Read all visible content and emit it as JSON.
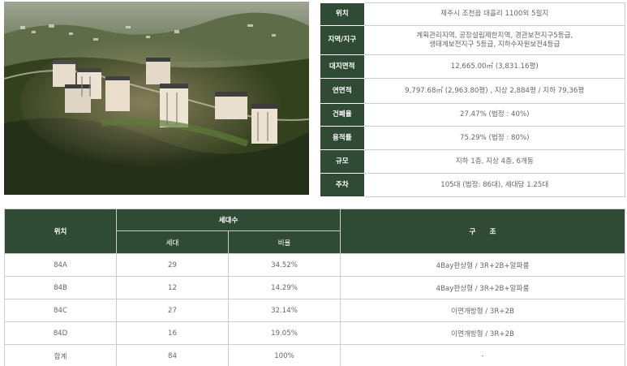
{
  "info": {
    "rows": [
      {
        "label": "위치",
        "value": "제주시 조천읍 대흘리 1100외 5필지"
      },
      {
        "label": "지역/지구",
        "value": "계획관리지역, 공장설립제한지역, 경관보전지구5등급,",
        "value2": "생태계보전지구 5등급, 지하수자원보전4등급"
      },
      {
        "label": "대지면적",
        "value": "12,665.00㎡ (3,831.16평)"
      },
      {
        "label": "연면적",
        "value": "9,797.68㎡ (2,963.80평) , 지상 2,884평 / 지하 79,36평"
      },
      {
        "label": "건폐율",
        "value": "27.47% (법정 : 40%)"
      },
      {
        "label": "용적률",
        "value": "75.29% (법정 : 80%)"
      },
      {
        "label": "규모",
        "value": "지하 1층, 지상 4층, 6개동"
      },
      {
        "label": "주차",
        "value": "105대 (법정: 86대), 세대당 1.25대"
      }
    ]
  },
  "units": {
    "headers": {
      "location": "위치",
      "households": "세대수",
      "households_count": "세대",
      "ratio": "비율",
      "structure": "구　　조"
    },
    "rows": [
      {
        "type": "84A",
        "count": "29",
        "ratio": "34.52%",
        "structure": "4Bay판상형 / 3R+2B+알파룸"
      },
      {
        "type": "84B",
        "count": "12",
        "ratio": "14.29%",
        "structure": "4Bay판상형 / 3R+2B+알파룸"
      },
      {
        "type": "84C",
        "count": "27",
        "ratio": "32.14%",
        "structure": "이면개방형 / 3R+2B"
      },
      {
        "type": "84D",
        "count": "16",
        "ratio": "19.05%",
        "structure": "이면개방형 / 3R+2B"
      },
      {
        "type": "합계",
        "count": "84",
        "ratio": "100%",
        "structure": "-"
      }
    ]
  }
}
